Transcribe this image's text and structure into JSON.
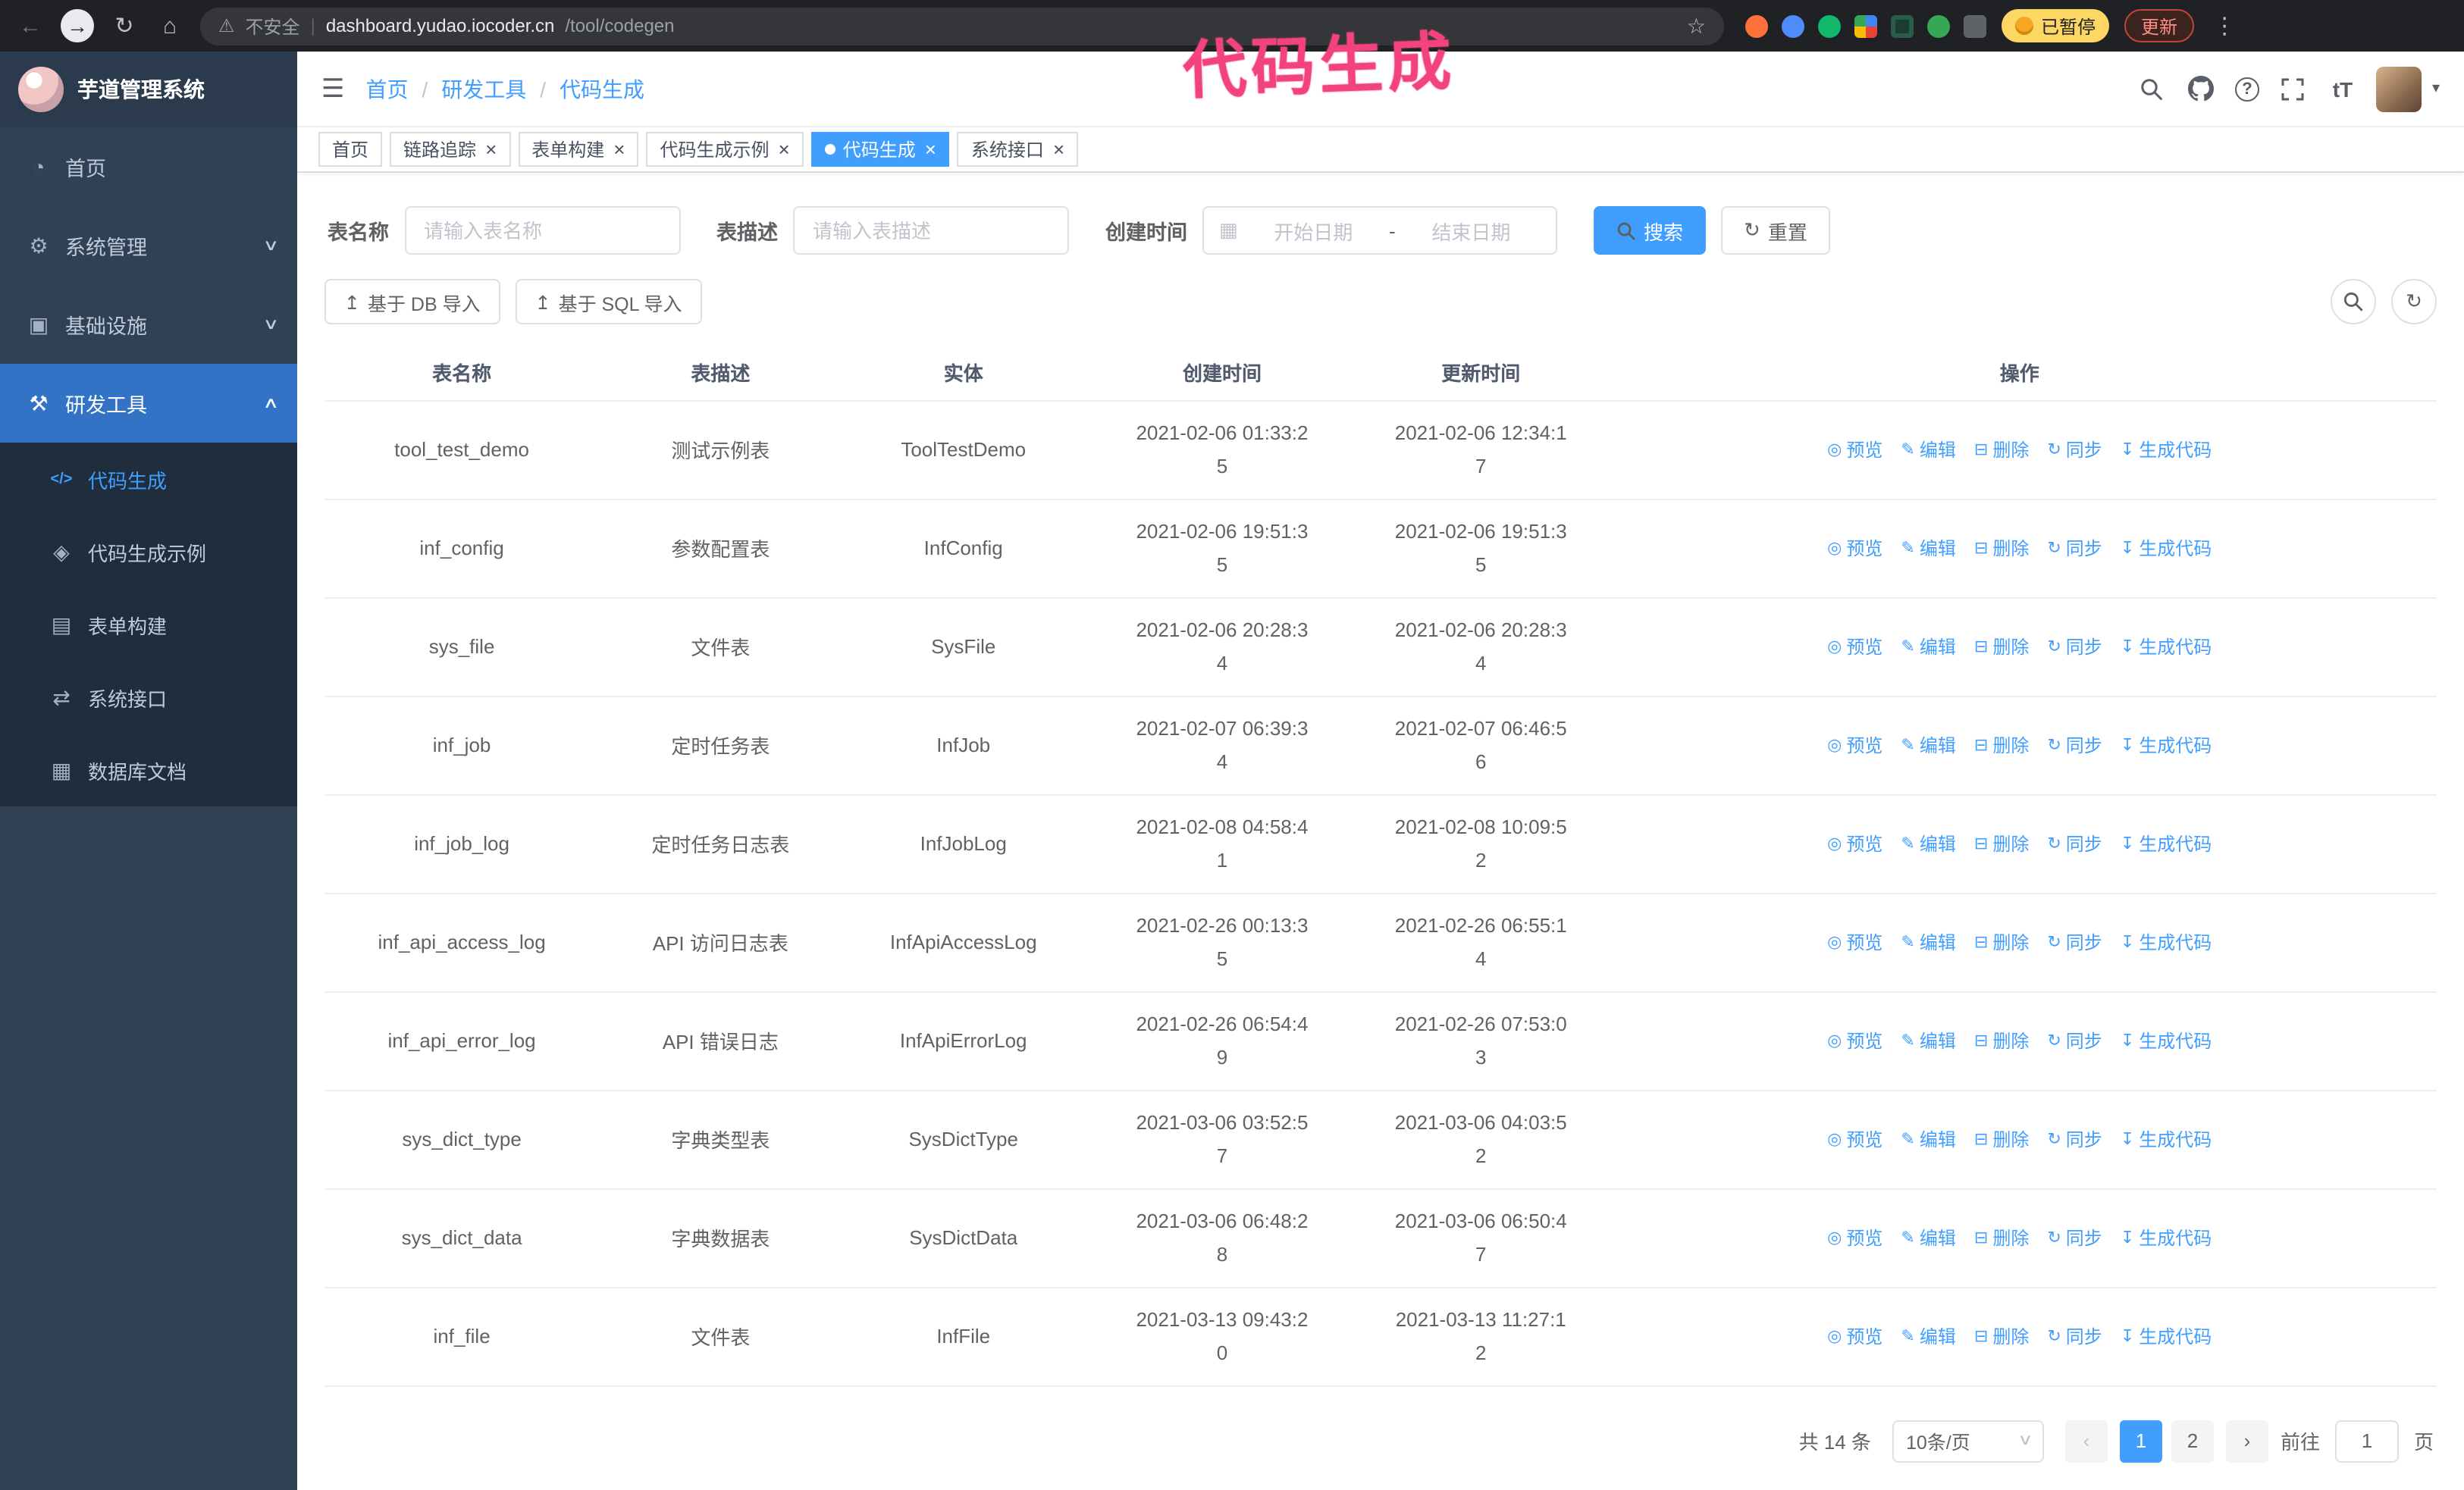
{
  "colors": {
    "accent": "#409EFF",
    "sidebar_bg": "#304156",
    "submenu_bg": "#1f2d3d",
    "active_menu_bg": "#3273c5",
    "annotation_pink": "#f2437c",
    "tag_active": "#409EFF"
  },
  "icons": {
    "back": "←",
    "forward": "→",
    "reload": "↻",
    "home": "⌂",
    "warning": "⚠",
    "pipe": "|",
    "star": "☆",
    "menu_dots": "⋮",
    "hamburger": "☰",
    "caret_down": "▾",
    "chevron_down": "∨",
    "chevron_up": "∧",
    "font_size": "tT",
    "question": "?",
    "upload": "↥",
    "refresh": "↻",
    "calendar": "▦",
    "close": "×",
    "prev": "‹",
    "next": "›",
    "select_caret": "∨",
    "slash": "/"
  },
  "annotation": {
    "text": "代码生成"
  },
  "browser": {
    "warning_label": "不安全",
    "url_domain": "dashboard.yudao.iocoder.cn",
    "url_path": "/tool/codegen",
    "paused_badge": "已暂停",
    "update_button": "更新"
  },
  "sidebar": {
    "title": "芋道管理系统",
    "menu": [
      {
        "id": "home",
        "label": "首页",
        "icon": "dashboard-icon",
        "glyph": "◔"
      },
      {
        "id": "system-management",
        "label": "系统管理",
        "icon": "gear-icon",
        "glyph": "⚙",
        "chevron": "down"
      },
      {
        "id": "infrastructure",
        "label": "基础设施",
        "icon": "infrastructure-icon",
        "glyph": "▣",
        "chevron": "down"
      },
      {
        "id": "dev-tools",
        "label": "研发工具",
        "icon": "tools-icon",
        "glyph": "⚒",
        "chevron": "up",
        "active": true
      }
    ],
    "submenu": [
      {
        "id": "codegen",
        "label": "代码生成",
        "icon": "code-icon",
        "glyph": "</>",
        "active": true
      },
      {
        "id": "codegen-example",
        "label": "代码生成示例",
        "icon": "example-icon",
        "glyph": "◈"
      },
      {
        "id": "form-builder",
        "label": "表单构建",
        "icon": "form-icon",
        "glyph": "▤"
      },
      {
        "id": "system-api",
        "label": "系统接口",
        "icon": "api-icon",
        "glyph": "⇄"
      },
      {
        "id": "db-doc",
        "label": "数据库文档",
        "icon": "db-doc-icon",
        "glyph": "▦"
      }
    ]
  },
  "header": {
    "breadcrumb": [
      "首页",
      "研发工具",
      "代码生成"
    ]
  },
  "tabs": [
    {
      "id": "home",
      "label": "首页",
      "closable": false,
      "active": false
    },
    {
      "id": "tracer",
      "label": "链路追踪",
      "closable": true,
      "active": false
    },
    {
      "id": "form-builder",
      "label": "表单构建",
      "closable": true,
      "active": false
    },
    {
      "id": "codegen-example",
      "label": "代码生成示例",
      "closable": true,
      "active": false
    },
    {
      "id": "codegen",
      "label": "代码生成",
      "closable": true,
      "active": true
    },
    {
      "id": "system-api",
      "label": "系统接口",
      "closable": true,
      "active": false
    }
  ],
  "filters": {
    "table_name_label": "表名称",
    "table_name_placeholder": "请输入表名称",
    "table_desc_label": "表描述",
    "table_desc_placeholder": "请输入表描述",
    "create_time_label": "创建时间",
    "start_date_placeholder": "开始日期",
    "range_separator": "-",
    "end_date_placeholder": "结束日期",
    "search_label": "搜索",
    "reset_label": "重置"
  },
  "toolbar": {
    "import_db_label": "基于 DB 导入",
    "import_sql_label": "基于 SQL 导入"
  },
  "table": {
    "columns": [
      "表名称",
      "表描述",
      "实体",
      "创建时间",
      "更新时间",
      "操作"
    ],
    "actions": [
      {
        "id": "preview",
        "label": "预览",
        "icon": "eye-icon",
        "glyph": "◎"
      },
      {
        "id": "edit",
        "label": "编辑",
        "icon": "edit-icon",
        "glyph": "✎"
      },
      {
        "id": "delete",
        "label": "删除",
        "icon": "delete-icon",
        "glyph": "⊟"
      },
      {
        "id": "sync",
        "label": "同步",
        "icon": "sync-icon",
        "glyph": "↻"
      },
      {
        "id": "generate",
        "label": "生成代码",
        "icon": "download-icon",
        "glyph": "↧"
      }
    ],
    "rows": [
      {
        "name": "tool_test_demo",
        "desc": "测试示例表",
        "entity": "ToolTestDemo",
        "created": "2021-02-06 01:33:25",
        "updated": "2021-02-06 12:34:17"
      },
      {
        "name": "inf_config",
        "desc": "参数配置表",
        "entity": "InfConfig",
        "created": "2021-02-06 19:51:35",
        "updated": "2021-02-06 19:51:35"
      },
      {
        "name": "sys_file",
        "desc": "文件表",
        "entity": "SysFile",
        "created": "2021-02-06 20:28:34",
        "updated": "2021-02-06 20:28:34"
      },
      {
        "name": "inf_job",
        "desc": "定时任务表",
        "entity": "InfJob",
        "created": "2021-02-07 06:39:34",
        "updated": "2021-02-07 06:46:56"
      },
      {
        "name": "inf_job_log",
        "desc": "定时任务日志表",
        "entity": "InfJobLog",
        "created": "2021-02-08 04:58:41",
        "updated": "2021-02-08 10:09:52"
      },
      {
        "name": "inf_api_access_log",
        "desc": "API 访问日志表",
        "entity": "InfApiAccessLog",
        "created": "2021-02-26 00:13:35",
        "updated": "2021-02-26 06:55:14"
      },
      {
        "name": "inf_api_error_log",
        "desc": "API 错误日志",
        "entity": "InfApiErrorLog",
        "created": "2021-02-26 06:54:49",
        "updated": "2021-02-26 07:53:03"
      },
      {
        "name": "sys_dict_type",
        "desc": "字典类型表",
        "entity": "SysDictType",
        "created": "2021-03-06 03:52:57",
        "updated": "2021-03-06 04:03:52"
      },
      {
        "name": "sys_dict_data",
        "desc": "字典数据表",
        "entity": "SysDictData",
        "created": "2021-03-06 06:48:28",
        "updated": "2021-03-06 06:50:47"
      },
      {
        "name": "inf_file",
        "desc": "文件表",
        "entity": "InfFile",
        "created": "2021-03-13 09:43:20",
        "updated": "2021-03-13 11:27:12"
      }
    ]
  },
  "pagination": {
    "total_label": "共 14 条",
    "page_size_label": "10条/页",
    "pages": [
      "1",
      "2"
    ],
    "current": "1",
    "goto_label": "前往",
    "goto_value": "1",
    "page_unit": "页"
  }
}
